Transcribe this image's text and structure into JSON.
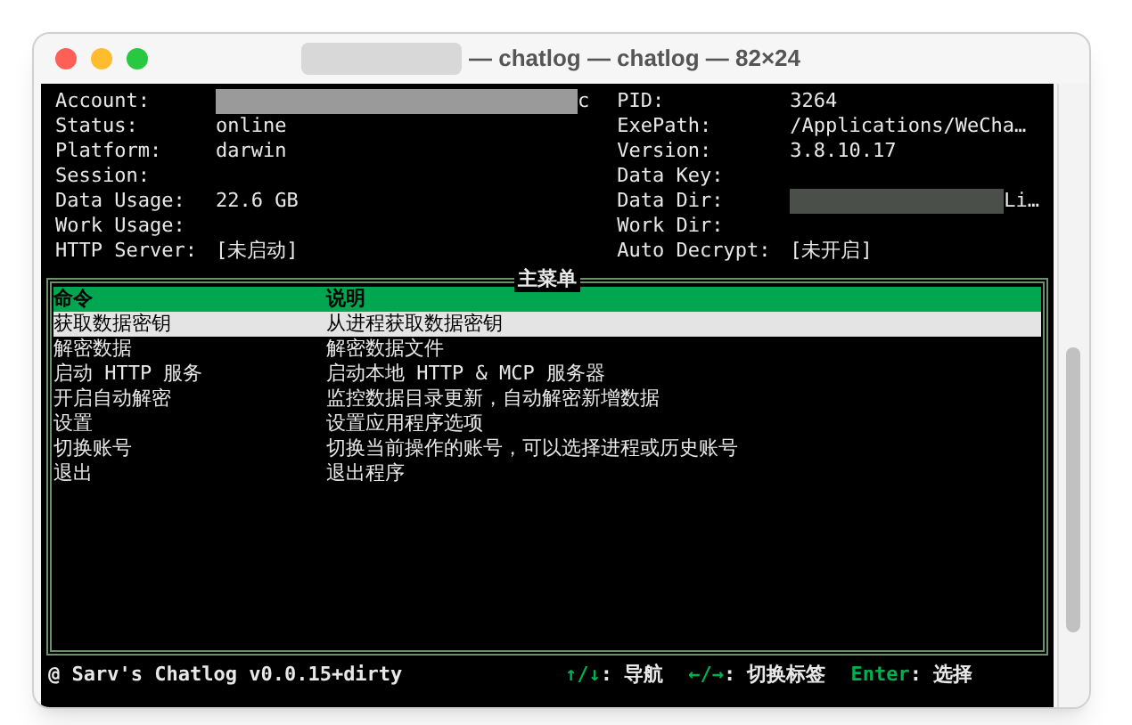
{
  "window": {
    "title": "— chatlog — chatlog — 82×24"
  },
  "info": {
    "left": [
      {
        "label": "Account:",
        "value": "c",
        "redacted": true
      },
      {
        "label": "Status:",
        "value": "online"
      },
      {
        "label": "Platform:",
        "value": "darwin"
      },
      {
        "label": "Session:"
      },
      {
        "label": "Data Usage:",
        "value": "22.6 GB"
      },
      {
        "label": "Work Usage:"
      },
      {
        "label": "HTTP Server:",
        "value": "[未启动]"
      }
    ],
    "right": [
      {
        "label": "PID:",
        "value": "3264"
      },
      {
        "label": "ExePath:",
        "value": "/Applications/WeCha…"
      },
      {
        "label": "Version:",
        "value": "3.8.10.17"
      },
      {
        "label": "Data Key:"
      },
      {
        "label": "Data Dir:",
        "value": "Li…",
        "redacted": true
      },
      {
        "label": "Work Dir:"
      },
      {
        "label": "Auto Decrypt:",
        "value": "[未开启]"
      }
    ]
  },
  "menu": {
    "title": "主菜单",
    "columns": [
      "命令",
      "说明"
    ],
    "items": [
      {
        "command": "获取数据密钥",
        "description": "从进程获取数据密钥",
        "selected": true
      },
      {
        "command": "解密数据",
        "description": "解密数据文件",
        "selected": false
      },
      {
        "command": "启动 HTTP 服务",
        "description": "启动本地 HTTP & MCP 服务器",
        "selected": false
      },
      {
        "command": "开启自动解密",
        "description": "监控数据目录更新，自动解密新增数据",
        "selected": false
      },
      {
        "command": "设置",
        "description": "设置应用程序选项",
        "selected": false
      },
      {
        "command": "切换账号",
        "description": "切换当前操作的账号，可以选择进程或历史账号",
        "selected": false
      },
      {
        "command": "退出",
        "description": "退出程序",
        "selected": false
      }
    ]
  },
  "status_bar": {
    "app": "@ Sarv's Chatlog v0.0.15+dirty",
    "hints": [
      {
        "key": "↑/↓",
        "label": ": 导航"
      },
      {
        "key": "←/→",
        "label": ": 切换标签"
      },
      {
        "key": "Enter",
        "label": ": 选择"
      }
    ]
  }
}
